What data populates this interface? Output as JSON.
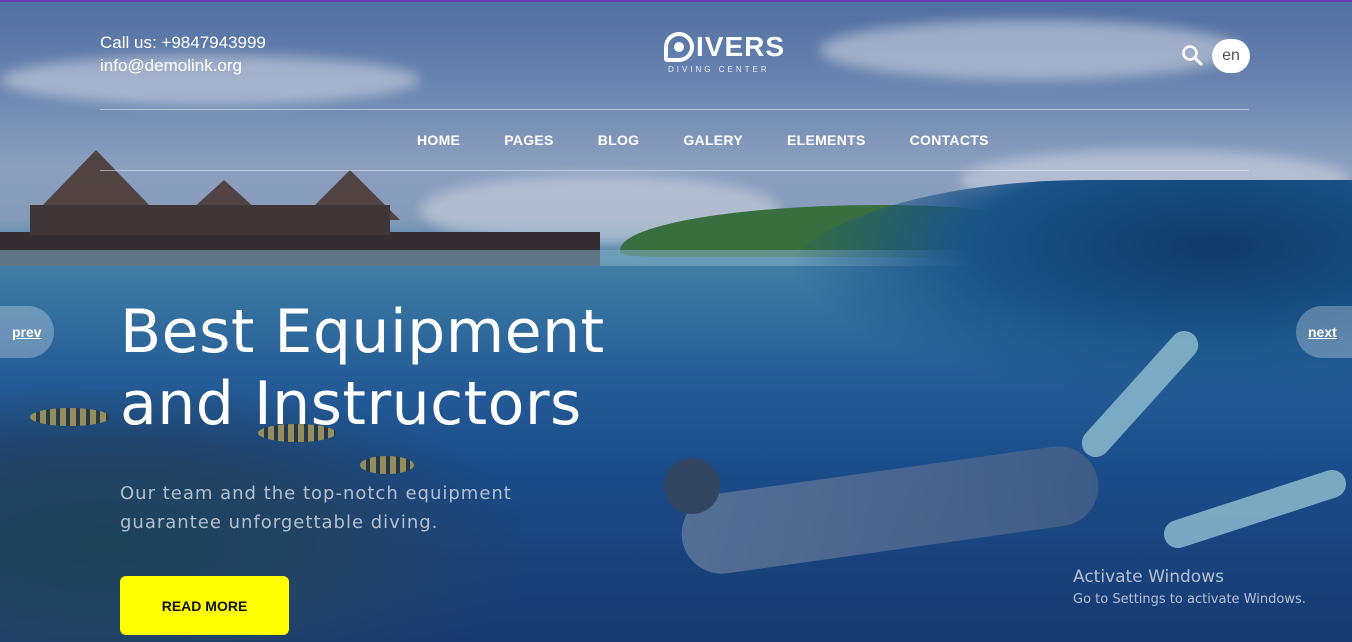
{
  "header": {
    "phone": "Call us: +9847943999",
    "email": "info@demolink.org",
    "logo": {
      "main": "IVERS",
      "sub": "DIVING CENTER"
    },
    "search_icon": "search-icon",
    "language": "en"
  },
  "nav": {
    "items": [
      {
        "label": "HOME"
      },
      {
        "label": "PAGES"
      },
      {
        "label": "BLOG"
      },
      {
        "label": "GALERY"
      },
      {
        "label": "ELEMENTS"
      },
      {
        "label": "CONTACTS"
      }
    ]
  },
  "slider": {
    "prev_label": "prev",
    "next_label": "next",
    "headline_line1": "Best Equipment",
    "headline_line2": "and Instructors",
    "tagline_line1": "Our team and the top-notch equipment",
    "tagline_line2": "guarantee unforgettable diving.",
    "cta_label": "READ MORE"
  },
  "watermark": {
    "title": "Activate Windows",
    "subtitle": "Go to Settings to activate Windows."
  },
  "colors": {
    "cta_background": "#ffff00",
    "top_border": "#7f3fbf",
    "text": "#ffffff"
  }
}
